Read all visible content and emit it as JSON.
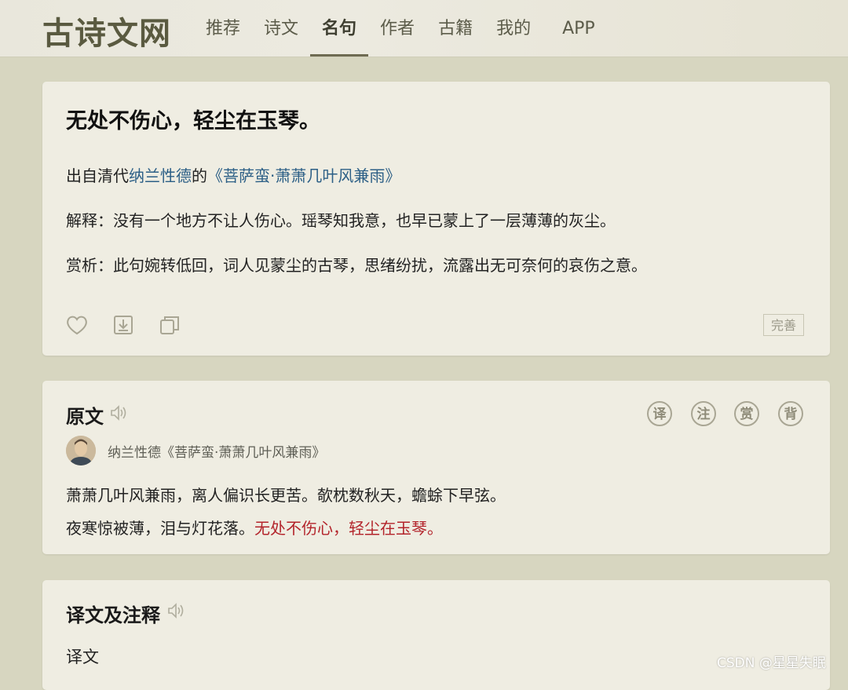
{
  "site": {
    "logo": "古诗文网"
  },
  "nav": {
    "items": [
      {
        "label": "推荐"
      },
      {
        "label": "诗文"
      },
      {
        "label": "名句"
      },
      {
        "label": "作者"
      },
      {
        "label": "古籍"
      },
      {
        "label": "我的"
      },
      {
        "label": "APP"
      }
    ],
    "active_index": 2
  },
  "sentence_card": {
    "quote": "无处不伤心，轻尘在玉琴。",
    "source_prefix": "出自清代",
    "author": "纳兰性德",
    "source_mid": "的",
    "work": "《菩萨蛮·萧萧几叶风兼雨》",
    "explanation": "解释：没有一个地方不让人伤心。瑶琴知我意，也早已蒙上了一层薄薄的灰尘。",
    "analysis": "赏析：此句婉转低回，词人见蒙尘的古琴，思绪纷扰，流露出无可奈何的哀伤之意。",
    "actions": {
      "like_icon": "heart-icon",
      "download_icon": "download-icon",
      "copy_icon": "copy-icon",
      "perfect_label": "完善"
    }
  },
  "original_card": {
    "title": "原文",
    "buttons": [
      "译",
      "注",
      "赏",
      "背"
    ],
    "author_line": "纳兰性德《菩萨蛮·萧萧几叶风兼雨》",
    "line1": "萧萧几叶风兼雨，离人偏识长更苦。欹枕数秋天，蟾蜍下早弦。",
    "line2_plain": "夜寒惊被薄，泪与灯花落。",
    "line2_highlight": "无处不伤心，轻尘在玉琴。"
  },
  "translation_card": {
    "title": "译文及注释",
    "subheading": "译文"
  },
  "watermark": "CSDN @星星失眠",
  "colors": {
    "link": "#2c5f86",
    "highlight": "#b3242b",
    "background": "#d7d6c0",
    "card": "#efede2"
  }
}
